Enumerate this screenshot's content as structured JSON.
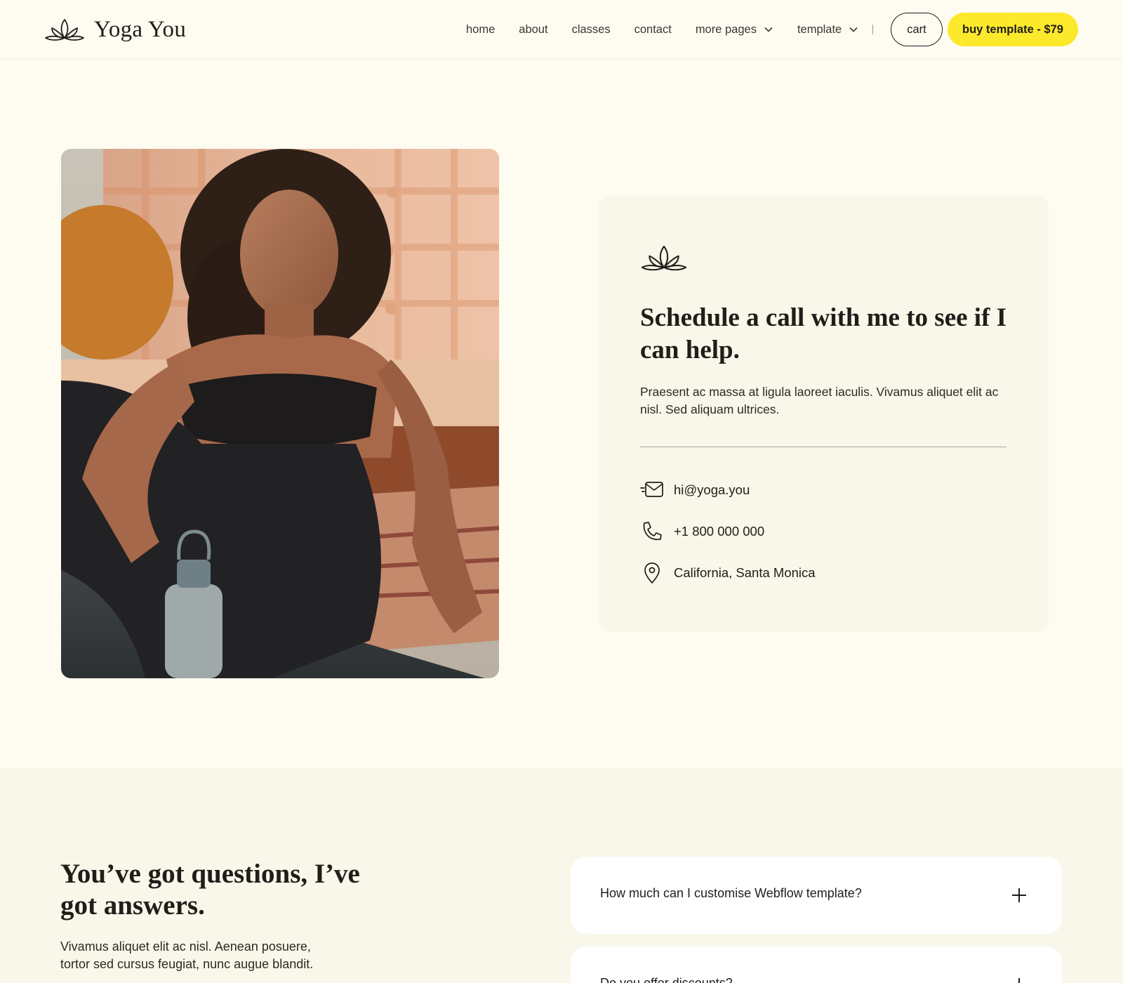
{
  "brand": {
    "name": "Yoga You",
    "logo_icon": "lotus-icon"
  },
  "nav": {
    "links": [
      {
        "label": "home"
      },
      {
        "label": "about"
      },
      {
        "label": "classes"
      },
      {
        "label": "contact"
      },
      {
        "label": "more pages",
        "dropdown": true
      },
      {
        "label": "template",
        "dropdown": true
      }
    ],
    "cart_label": "cart",
    "buy_label": "buy template - $79",
    "accent_color": "#fde92b"
  },
  "hero": {
    "photo_description_icon": "woman-sitting-yoga-photo",
    "card": {
      "title": "Schedule a call with me to see if I can help.",
      "description": "Praesent ac massa at ligula laoreet iaculis. Vivamus aliquet elit ac nisl. Sed aliquam ultrices.",
      "contacts": {
        "email": {
          "icon": "mail-icon",
          "value": "hi@yoga.you"
        },
        "phone": {
          "icon": "phone-icon",
          "value": "+1 800 000 000"
        },
        "location": {
          "icon": "location-pin-icon",
          "value": "California, Santa Monica"
        }
      }
    }
  },
  "faq": {
    "title": "You’ve got questions, I’ve got answers.",
    "description": "Vivamus aliquet elit ac nisl. Aenean posuere, tortor sed cursus feugiat, nunc augue blandit.",
    "items": [
      {
        "question": "How much can I customise Webflow template?"
      },
      {
        "question": "Do you offer discounts?"
      }
    ]
  }
}
